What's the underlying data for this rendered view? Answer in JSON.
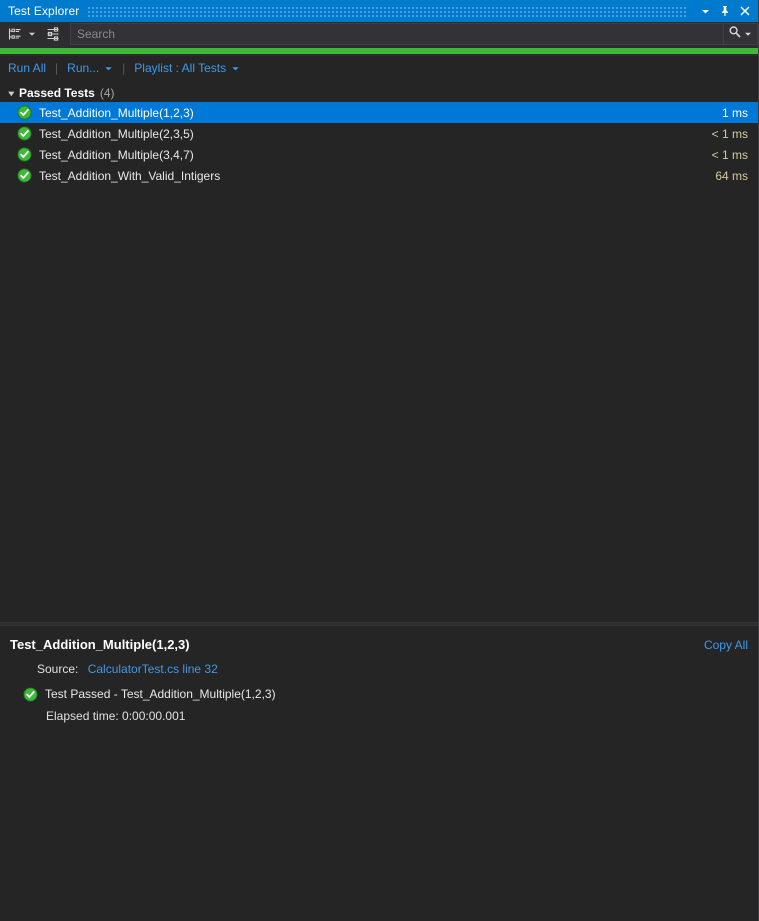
{
  "window": {
    "title": "Test Explorer",
    "controls": [
      {
        "name": "window-dropdown-button",
        "icon": "chevron-down-icon"
      },
      {
        "name": "pin-button",
        "icon": "pin-icon"
      },
      {
        "name": "close-button",
        "icon": "close-icon"
      }
    ]
  },
  "toolbar": {
    "group_by_icon": "group-by-icon",
    "group_by_caret": "chevron-down-icon",
    "settings_icon": "test-settings-icon",
    "search": {
      "placeholder": "Search",
      "value": "",
      "icon": "search-icon",
      "caret": "chevron-down-icon"
    }
  },
  "progress": {
    "percent": 100,
    "color": "#3fb93a"
  },
  "commands": {
    "run_all": "Run All",
    "separator": "|",
    "run": "Run...",
    "playlist": "Playlist : All Tests",
    "caret": "chevron-down-icon"
  },
  "test_list": {
    "group": {
      "expander": "triangle-down-icon",
      "title": "Passed Tests",
      "count": "(4)"
    },
    "rows": [
      {
        "status_icon": "passed-icon",
        "name": "Test_Addition_Multiple(1,2,3)",
        "duration": "1 ms",
        "selected": true
      },
      {
        "status_icon": "passed-icon",
        "name": "Test_Addition_Multiple(2,3,5)",
        "duration": "< 1 ms",
        "selected": false
      },
      {
        "status_icon": "passed-icon",
        "name": "Test_Addition_Multiple(3,4,7)",
        "duration": "< 1 ms",
        "selected": false
      },
      {
        "status_icon": "passed-icon",
        "name": "Test_Addition_With_Valid_Intigers",
        "duration": "64 ms",
        "selected": false
      }
    ]
  },
  "detail": {
    "title": "Test_Addition_Multiple(1,2,3)",
    "copy_all": "Copy All",
    "source_label": "Source:",
    "source_link": "CalculatorTest.cs line 32",
    "result_icon": "passed-icon",
    "result_text": "Test Passed - Test_Addition_Multiple(1,2,3)",
    "elapsed": "Elapsed time: 0:00:00.001"
  },
  "colors": {
    "title_bar": "#007acc",
    "selection": "#0078d7",
    "link": "#3d9ae8",
    "pass_green": "#3fb93a",
    "duration_text": "#d4c9a0",
    "background": "#252526",
    "toolbar_background": "#2d2d30"
  }
}
